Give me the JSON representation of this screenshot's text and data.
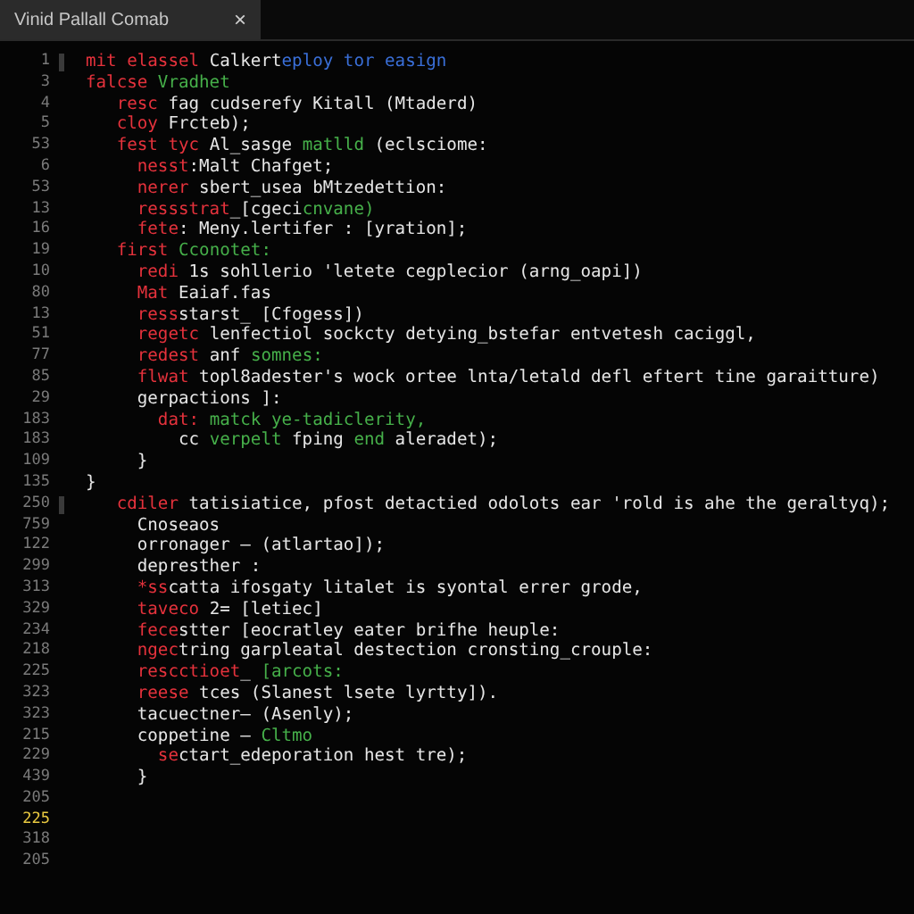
{
  "tab": {
    "title": "Vinid Pallall Comab",
    "close": "×"
  },
  "lines": [
    {
      "number": "1",
      "marker": true,
      "tokens": [
        {
          "kind": "keyword",
          "text": "mit elassel"
        },
        {
          "kind": "plain",
          "text": " Calkert"
        },
        {
          "kind": "func",
          "text": "eploy tor easign"
        }
      ]
    },
    {
      "number": "3",
      "marker": false,
      "tokens": [
        {
          "kind": "keyword",
          "text": "falcse"
        },
        {
          "kind": "type",
          "text": " Vradhet"
        }
      ]
    },
    {
      "number": "4",
      "marker": false,
      "tokens": [
        {
          "kind": "keyword",
          "text": "   resc"
        },
        {
          "kind": "plain",
          "text": " fag cudserefy Kitall (Mtaderd)"
        }
      ]
    },
    {
      "number": "5",
      "marker": false,
      "tokens": [
        {
          "kind": "keyword",
          "text": "   cloy"
        },
        {
          "kind": "plain",
          "text": " Frcteb);"
        }
      ]
    },
    {
      "number": "53",
      "marker": false,
      "tokens": [
        {
          "kind": "keyword",
          "text": "   fest tyc"
        },
        {
          "kind": "plain",
          "text": " Al_sasge "
        },
        {
          "kind": "type",
          "text": "matlld"
        },
        {
          "kind": "plain",
          "text": " (eclsciome:"
        }
      ]
    },
    {
      "number": "6",
      "marker": false,
      "tokens": [
        {
          "kind": "keyword",
          "text": "     nesst"
        },
        {
          "kind": "plain",
          "text": ":Malt Chafget;"
        }
      ]
    },
    {
      "number": "53",
      "marker": false,
      "tokens": [
        {
          "kind": "keyword",
          "text": "     nerer"
        },
        {
          "kind": "plain",
          "text": " sbert_usea bMtzedettion:"
        }
      ]
    },
    {
      "number": "13",
      "marker": false,
      "tokens": [
        {
          "kind": "keyword",
          "text": "     ressstrat"
        },
        {
          "kind": "plain",
          "text": "_[cgeci"
        },
        {
          "kind": "type",
          "text": "cnvane)"
        }
      ]
    },
    {
      "number": "16",
      "marker": false,
      "tokens": [
        {
          "kind": "keyword",
          "text": "     fete"
        },
        {
          "kind": "plain",
          "text": ": Meny.lertifer : [yration];"
        }
      ]
    },
    {
      "number": "19",
      "marker": false,
      "tokens": [
        {
          "kind": "keyword",
          "text": "   first"
        },
        {
          "kind": "type",
          "text": " Cconotet:"
        }
      ]
    },
    {
      "number": "10",
      "marker": false,
      "tokens": [
        {
          "kind": "keyword",
          "text": "     redi"
        },
        {
          "kind": "plain",
          "text": " 1s sohllerio 'letete cegplecior (arng_oapi])"
        }
      ]
    },
    {
      "number": "80",
      "marker": false,
      "tokens": [
        {
          "kind": "keyword",
          "text": "     Mat"
        },
        {
          "kind": "plain",
          "text": " Eaiaf.fas"
        }
      ]
    },
    {
      "number": "13",
      "marker": false,
      "tokens": [
        {
          "kind": "keyword",
          "text": "     ress"
        },
        {
          "kind": "plain",
          "text": "starst_ [Cfogess])"
        }
      ]
    },
    {
      "number": "51",
      "marker": false,
      "tokens": [
        {
          "kind": "keyword",
          "text": "     regetc"
        },
        {
          "kind": "plain",
          "text": " lenfectiol sockcty detying_bstefar entvetesh caciggl,"
        }
      ]
    },
    {
      "number": "77",
      "marker": false,
      "tokens": [
        {
          "kind": "keyword",
          "text": "     redest"
        },
        {
          "kind": "plain",
          "text": " anf "
        },
        {
          "kind": "type",
          "text": "somnes:"
        }
      ]
    },
    {
      "number": "85",
      "marker": false,
      "tokens": [
        {
          "kind": "keyword",
          "text": "     flwat"
        },
        {
          "kind": "plain",
          "text": " topl8adester's wock ortee lnta/letald defl eftert tine garaitture)"
        }
      ]
    },
    {
      "number": "29",
      "marker": false,
      "tokens": [
        {
          "kind": "plain",
          "text": "     gerpactions ]:"
        }
      ]
    },
    {
      "number": "183",
      "marker": false,
      "tokens": [
        {
          "kind": "keyword",
          "text": "       dat:"
        },
        {
          "kind": "type",
          "text": " matck ye-tadiclerity,"
        }
      ]
    },
    {
      "number": "183",
      "marker": false,
      "tokens": [
        {
          "kind": "plain",
          "text": "         cc "
        },
        {
          "kind": "type",
          "text": "verpelt"
        },
        {
          "kind": "plain",
          "text": " fping "
        },
        {
          "kind": "type",
          "text": "end"
        },
        {
          "kind": "plain",
          "text": " aleradet);"
        }
      ]
    },
    {
      "number": "109",
      "marker": false,
      "tokens": [
        {
          "kind": "plain",
          "text": "     }"
        }
      ]
    },
    {
      "number": "135",
      "marker": false,
      "tokens": [
        {
          "kind": "plain",
          "text": "}"
        }
      ]
    },
    {
      "number": "250",
      "marker": true,
      "tokens": [
        {
          "kind": "keyword",
          "text": "   cdiler"
        },
        {
          "kind": "plain",
          "text": " tatisiatice, pfost detactied odolots ear 'rold is ahe the geraltyq);"
        }
      ]
    },
    {
      "number": "759",
      "marker": false,
      "tokens": [
        {
          "kind": "plain",
          "text": "     Cnoseaos"
        }
      ]
    },
    {
      "number": "122",
      "marker": false,
      "tokens": [
        {
          "kind": "plain",
          "text": "     orronager – (atlartao]);"
        }
      ]
    },
    {
      "number": "299",
      "marker": false,
      "tokens": [
        {
          "kind": "plain",
          "text": "     depresther :"
        }
      ]
    },
    {
      "number": "313",
      "marker": false,
      "tokens": [
        {
          "kind": "keyword",
          "text": "     *ss"
        },
        {
          "kind": "plain",
          "text": "catta ifosgaty litalet is syontal errer grode,"
        }
      ]
    },
    {
      "number": "329",
      "marker": false,
      "tokens": [
        {
          "kind": "keyword",
          "text": "     taveco"
        },
        {
          "kind": "plain",
          "text": " 2= [letiec]"
        }
      ]
    },
    {
      "number": "234",
      "marker": false,
      "tokens": [
        {
          "kind": "keyword",
          "text": "     fece"
        },
        {
          "kind": "plain",
          "text": "stter [eocratley eater brifhe heuple:"
        }
      ]
    },
    {
      "number": "218",
      "marker": false,
      "tokens": [
        {
          "kind": "keyword",
          "text": "     ngec"
        },
        {
          "kind": "plain",
          "text": "tring garpleatal destection cronsting_crouple:"
        }
      ]
    },
    {
      "number": "225",
      "marker": false,
      "tokens": [
        {
          "kind": "keyword",
          "text": "     rescctioet"
        },
        {
          "kind": "plain",
          "text": "_ "
        },
        {
          "kind": "type",
          "text": "[arcots:"
        }
      ]
    },
    {
      "number": "323",
      "marker": false,
      "tokens": [
        {
          "kind": "keyword",
          "text": "     reese"
        },
        {
          "kind": "plain",
          "text": " tces (Slanest lsete lyrtty])."
        }
      ]
    },
    {
      "number": "323",
      "marker": false,
      "tokens": [
        {
          "kind": "plain",
          "text": "     tacuectner– (Asenly);"
        }
      ]
    },
    {
      "number": "215",
      "marker": false,
      "tokens": [
        {
          "kind": "plain",
          "text": "     coppetine – "
        },
        {
          "kind": "type",
          "text": "Cltmo"
        }
      ]
    },
    {
      "number": "229",
      "marker": false,
      "tokens": [
        {
          "kind": "keyword",
          "text": "       se"
        },
        {
          "kind": "plain",
          "text": "ctart_edeporation hest tre);"
        }
      ]
    },
    {
      "number": "439",
      "marker": false,
      "tokens": [
        {
          "kind": "plain",
          "text": "     }"
        }
      ]
    },
    {
      "number": "205",
      "marker": false
    },
    {
      "number": "225",
      "marker": false,
      "current": true
    },
    {
      "number": "318",
      "marker": false
    },
    {
      "number": "205",
      "marker": false
    }
  ]
}
